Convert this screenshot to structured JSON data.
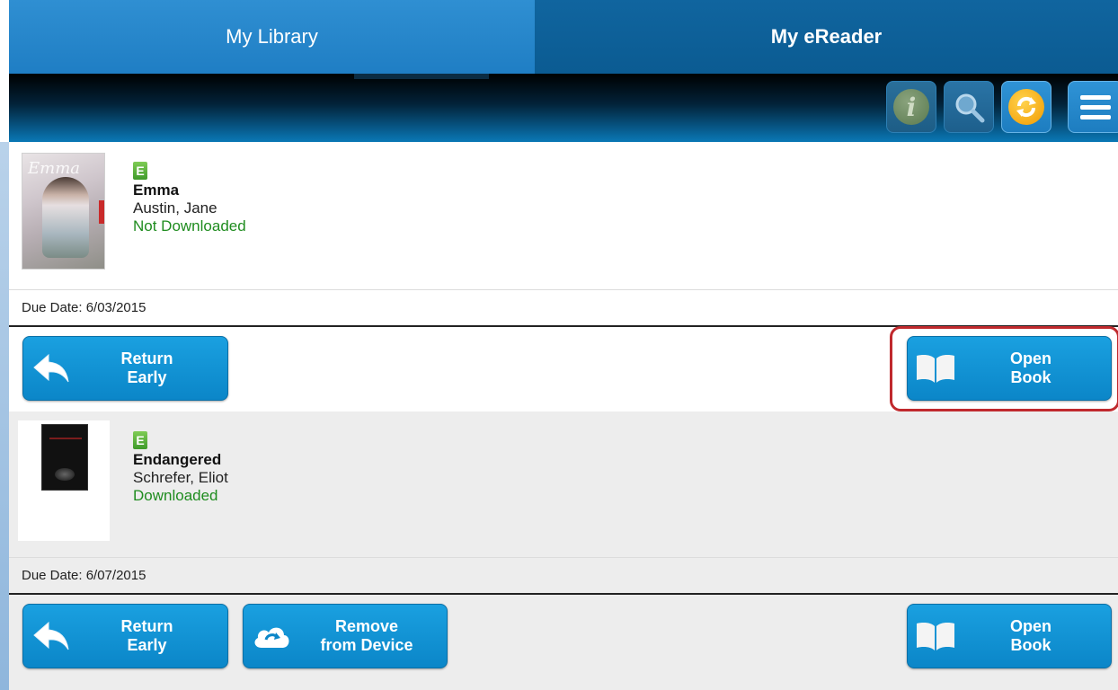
{
  "tabs": {
    "my_library": "My Library",
    "my_ereader": "My eReader"
  },
  "toolbar": {
    "icons": [
      "info-icon",
      "search-icon",
      "sync-icon",
      "menu-icon"
    ],
    "info_glyph": "i"
  },
  "books": [
    {
      "format_badge": "E",
      "title": "Emma",
      "author": "Austin, Jane",
      "status": "Not Downloaded",
      "due_date": "Due Date: 6/03/2015",
      "actions": {
        "return_line1": "Return",
        "return_line2": "Early",
        "open_line1": "Open",
        "open_line2": "Book"
      }
    },
    {
      "format_badge": "E",
      "title": "Endangered",
      "author": "Schrefer, Eliot",
      "status": "Downloaded",
      "due_date": "Due Date: 6/07/2015",
      "actions": {
        "return_line1": "Return",
        "return_line2": "Early",
        "remove_line1": "Remove",
        "remove_line2": "from Device",
        "open_line1": "Open",
        "open_line2": "Book"
      }
    }
  ],
  "colors": {
    "tab_active": "#0b5b92",
    "tab_inactive": "#1f7ec4",
    "button": "#0b86c8",
    "status_green": "#1f8c1f",
    "highlight_red": "#c0292d"
  }
}
